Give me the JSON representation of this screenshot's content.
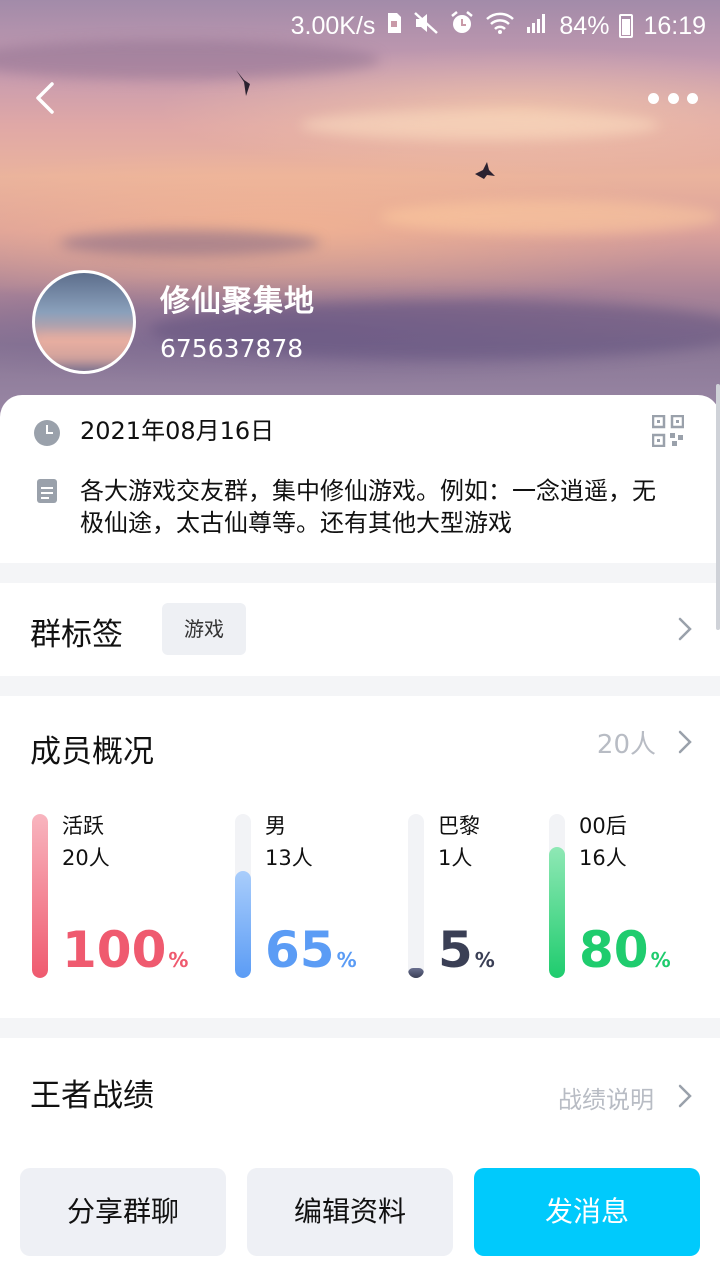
{
  "status_bar": {
    "network_speed": "3.00K/s",
    "battery_percent": "84%",
    "time": "16:19",
    "icons": [
      "storage-icon",
      "mute-icon",
      "alarm-icon",
      "wifi-icon",
      "signal-icon",
      "battery-icon"
    ]
  },
  "header": {
    "group_name": "修仙聚集地",
    "group_id": "675637878",
    "back_icon": "chevron-left-icon",
    "more_icon": "more-dots-icon"
  },
  "info": {
    "created_date": "2021年08月16日",
    "description": "各大游戏交友群，集中修仙游戏。例如：一念逍遥，无极仙途，太古仙尊等。还有其他大型游戏"
  },
  "tags": {
    "title": "群标签",
    "items": [
      "游戏"
    ]
  },
  "members": {
    "title": "成员概况",
    "total": "20人",
    "stats": [
      {
        "label": "活跃",
        "count": "20人",
        "percent": "100",
        "unit": "%",
        "fill": 1.0,
        "color": "#ef5a6f",
        "light": "#f8b5bf"
      },
      {
        "label": "男",
        "count": "13人",
        "percent": "65",
        "unit": "%",
        "fill": 0.65,
        "color": "#5b9cf5",
        "light": "#a9cdfb"
      },
      {
        "label": "巴黎",
        "count": "1人",
        "percent": "5",
        "unit": "%",
        "fill": 0.05,
        "color": "#3a3f55",
        "light": "#6a7090"
      },
      {
        "label": "00后",
        "count": "16人",
        "percent": "80",
        "unit": "%",
        "fill": 0.8,
        "color": "#1fcc6e",
        "light": "#8fe8b5"
      }
    ]
  },
  "honor": {
    "title": "王者战绩",
    "link": "战绩说明"
  },
  "actions": {
    "share": "分享群聊",
    "edit": "编辑资料",
    "send": "发消息"
  },
  "colors": {
    "accent": "#00cafc",
    "secondary_text": "#b8bcc4"
  }
}
